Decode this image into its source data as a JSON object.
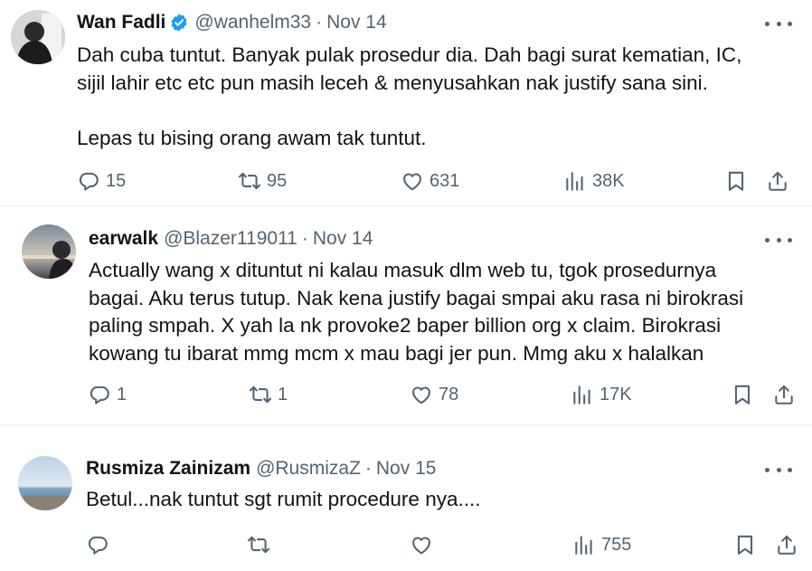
{
  "tweets": [
    {
      "name": "Wan Fadli",
      "verified": true,
      "handle": "@wanhelm33",
      "sep": "·",
      "date": "Nov 14",
      "text": "Dah cuba tuntut. Banyak pulak prosedur dia. Dah bagi surat kematian, IC,\nsijil lahir etc etc pun masih leceh & menyusahkan nak justify sana sini.\n\nLepas tu bising orang awam tak tuntut.",
      "replies": "15",
      "retweets": "95",
      "likes": "631",
      "views": "38K"
    },
    {
      "name": "earwalk",
      "handle": "@Blazer119011",
      "sep": "·",
      "date": "Nov 14",
      "text": "Actually wang x dituntut ni kalau masuk dlm web tu, tgok prosedurnya\nbagai. Aku terus tutup. Nak kena justify bagai smpai aku rasa ni birokrasi\npaling smpah. X yah la nk provoke2 baper billion org x claim. Birokrasi\nkowang tu ibarat mmg mcm x mau bagi jer pun. Mmg aku x halalkan",
      "replies": "1",
      "retweets": "1",
      "likes": "78",
      "views": "17K"
    },
    {
      "name": "Rusmiza Zainizam",
      "handle": "@RusmizaZ",
      "sep": "·",
      "date": "Nov 15",
      "text": "Betul...nak tuntut sgt rumit procedure nya....",
      "replies": "",
      "retweets": "",
      "likes": "",
      "views": "755"
    }
  ],
  "colors": {
    "text": "#0f1419",
    "secondary": "#536471",
    "verified": "#1d9bf0",
    "divider": "#eff3f4"
  },
  "icons": [
    "reply-icon",
    "retweet-icon",
    "like-icon",
    "views-icon",
    "bookmark-icon",
    "share-icon",
    "more-icon",
    "verified-badge-icon"
  ]
}
